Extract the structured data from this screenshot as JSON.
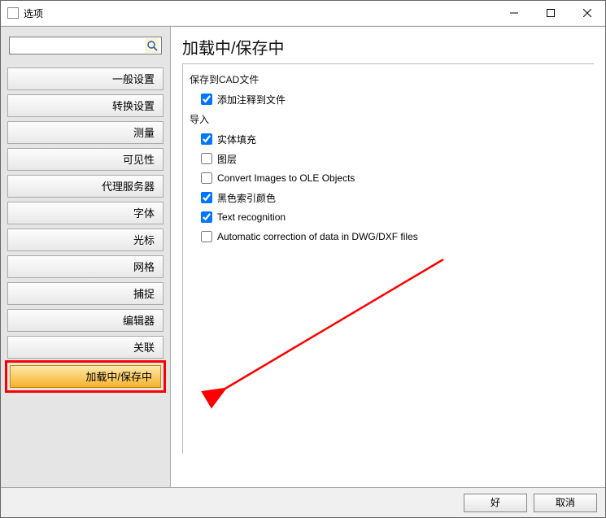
{
  "window": {
    "title": "选项"
  },
  "search": {
    "value": "",
    "placeholder": ""
  },
  "sidebar": {
    "items": [
      {
        "label": "一般设置",
        "selected": false
      },
      {
        "label": "转换设置",
        "selected": false
      },
      {
        "label": "测量",
        "selected": false
      },
      {
        "label": "可见性",
        "selected": false
      },
      {
        "label": "代理服务器",
        "selected": false
      },
      {
        "label": "字体",
        "selected": false
      },
      {
        "label": "光标",
        "selected": false
      },
      {
        "label": "网格",
        "selected": false
      },
      {
        "label": "捕捉",
        "selected": false
      },
      {
        "label": "编辑器",
        "selected": false
      },
      {
        "label": "关联",
        "selected": false
      },
      {
        "label": "加载中/保存中",
        "selected": true
      }
    ]
  },
  "page": {
    "title": "加载中/保存中",
    "group1_title": "保存到CAD文件",
    "group2_title": "导入",
    "checks": {
      "annotate": {
        "label": "添加注释到文件",
        "checked": true
      },
      "solidFill": {
        "label": "实体填充",
        "checked": true
      },
      "layers": {
        "label": "图层",
        "checked": false
      },
      "convertOLE": {
        "label": "Convert Images to OLE Objects",
        "checked": false
      },
      "blackIndex": {
        "label": "黑色索引颜色",
        "checked": true
      },
      "textRecog": {
        "label": "Text recognition",
        "checked": true
      },
      "autoCorrect": {
        "label": "Automatic correction of data in DWG/DXF files",
        "checked": false
      }
    }
  },
  "footer": {
    "ok": "好",
    "cancel": "取消"
  }
}
